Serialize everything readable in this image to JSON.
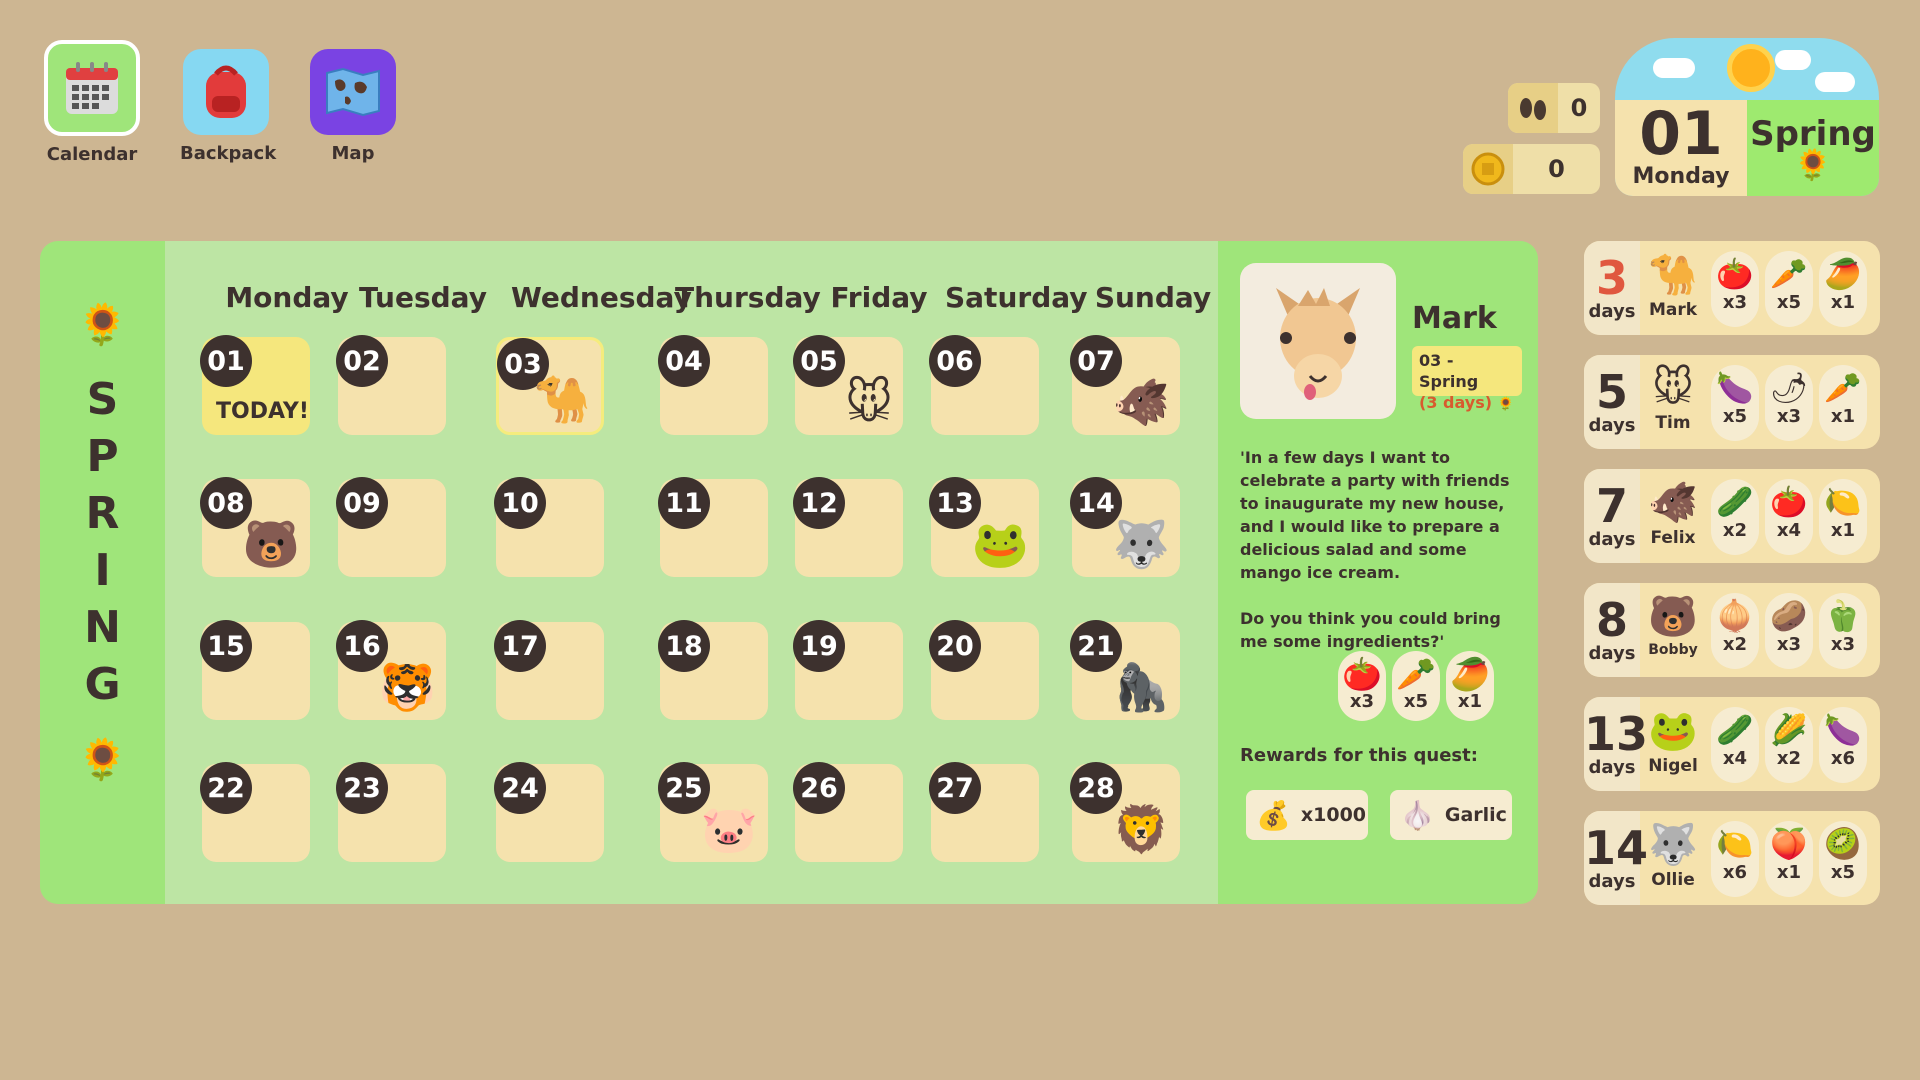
{
  "nav": [
    {
      "label": "Calendar",
      "icon": "calendar-icon",
      "glyph": "📅"
    },
    {
      "label": "Backpack",
      "icon": "backpack-icon",
      "glyph": "🎒"
    },
    {
      "label": "Map",
      "icon": "map-icon",
      "glyph": "🗺"
    }
  ],
  "counters": {
    "steps": {
      "icon": "footprints-icon",
      "glyph": "👣",
      "value": "0"
    },
    "coins": {
      "icon": "coin-icon",
      "glyph": "🪙",
      "value": "0"
    }
  },
  "date": {
    "day": "01",
    "weekday": "Monday",
    "season": "Spring",
    "season_glyph": "🌻"
  },
  "season_strip": {
    "letters": [
      "S",
      "P",
      "R",
      "I",
      "N",
      "G"
    ],
    "flower": "🌻"
  },
  "weekdays": [
    "Monday",
    "Tuesday",
    "Wednesday",
    "Thursday",
    "Friday",
    "Saturday",
    "Sunday"
  ],
  "calendar": [
    {
      "day": "01",
      "today": "TODAY!",
      "animal": ""
    },
    {
      "day": "02",
      "animal": ""
    },
    {
      "day": "03",
      "animal": "🐪",
      "selected": true
    },
    {
      "day": "04",
      "animal": ""
    },
    {
      "day": "05",
      "animal": "🐭"
    },
    {
      "day": "06",
      "animal": ""
    },
    {
      "day": "07",
      "animal": "🐗"
    },
    {
      "day": "08",
      "animal": "🐻"
    },
    {
      "day": "09",
      "animal": ""
    },
    {
      "day": "10",
      "animal": ""
    },
    {
      "day": "11",
      "animal": ""
    },
    {
      "day": "12",
      "animal": ""
    },
    {
      "day": "13",
      "animal": "🐸"
    },
    {
      "day": "14",
      "animal": "🐺"
    },
    {
      "day": "15",
      "animal": ""
    },
    {
      "day": "16",
      "animal": "🐯"
    },
    {
      "day": "17",
      "animal": ""
    },
    {
      "day": "18",
      "animal": ""
    },
    {
      "day": "19",
      "animal": ""
    },
    {
      "day": "20",
      "animal": ""
    },
    {
      "day": "21",
      "animal": "🦍"
    },
    {
      "day": "22",
      "animal": ""
    },
    {
      "day": "23",
      "animal": ""
    },
    {
      "day": "24",
      "animal": ""
    },
    {
      "day": "25",
      "animal": "🐷"
    },
    {
      "day": "26",
      "animal": ""
    },
    {
      "day": "27",
      "animal": ""
    },
    {
      "day": "28",
      "animal": "🦁"
    }
  ],
  "quest": {
    "portrait": "🐪",
    "name": "Mark",
    "due": "03 - Spring",
    "due_days": "(3 days)",
    "due_glyph": "🌻",
    "text1": "'In a few days I want to celebrate a party with friends to inaugurate my new house, and I would like to prepare a delicious salad and some mango ice cream.",
    "text2": "Do you think you could bring me some ingredients?'",
    "items": [
      {
        "glyph": "🍅",
        "qty": "x3"
      },
      {
        "glyph": "🥕",
        "qty": "x5"
      },
      {
        "glyph": "🥭",
        "qty": "x1"
      }
    ],
    "reward_title": "Rewards for this quest:",
    "rewards": [
      {
        "glyph": "💰",
        "label": "x1000"
      },
      {
        "glyph": "🧄",
        "label": "Garlic"
      }
    ]
  },
  "quest_list": [
    {
      "days": "3",
      "urgent": true,
      "label": "days",
      "face": "🐪",
      "name": "Mark",
      "items": [
        {
          "glyph": "🍅",
          "qty": "x3"
        },
        {
          "glyph": "🥕",
          "qty": "x5"
        },
        {
          "glyph": "🥭",
          "qty": "x1"
        }
      ]
    },
    {
      "days": "5",
      "label": "days",
      "face": "🐭",
      "name": "Tim",
      "items": [
        {
          "glyph": "🍆",
          "qty": "x5"
        },
        {
          "glyph": "🌶",
          "qty": "x3"
        },
        {
          "glyph": "🥕",
          "qty": "x1"
        }
      ]
    },
    {
      "days": "7",
      "label": "days",
      "face": "🐗",
      "name": "Felix",
      "items": [
        {
          "glyph": "🥒",
          "qty": "x2"
        },
        {
          "glyph": "🍅",
          "qty": "x4"
        },
        {
          "glyph": "🍋",
          "qty": "x1"
        }
      ]
    },
    {
      "days": "8",
      "label": "days",
      "face": "🐻",
      "name": "Bobby",
      "items": [
        {
          "glyph": "🧅",
          "qty": "x2"
        },
        {
          "glyph": "🥔",
          "qty": "x3"
        },
        {
          "glyph": "🫑",
          "qty": "x3"
        }
      ]
    },
    {
      "days": "13",
      "label": "days",
      "face": "🐸",
      "name": "Nigel",
      "items": [
        {
          "glyph": "🥒",
          "qty": "x4"
        },
        {
          "glyph": "🌽",
          "qty": "x2"
        },
        {
          "glyph": "🍆",
          "qty": "x6"
        }
      ]
    },
    {
      "days": "14",
      "label": "days",
      "face": "🐺",
      "name": "Ollie",
      "items": [
        {
          "glyph": "🍋",
          "qty": "x6"
        },
        {
          "glyph": "🍑",
          "qty": "x1"
        },
        {
          "glyph": "🥝",
          "qty": "x5"
        }
      ]
    }
  ],
  "colors": {
    "background": "#cdb692",
    "panel": "#9fe57a",
    "grid": "#bde5a4",
    "cell": "#f5e2ad",
    "today": "#f5e77d",
    "badge": "#3d312e",
    "urgent": "#e0573f"
  }
}
